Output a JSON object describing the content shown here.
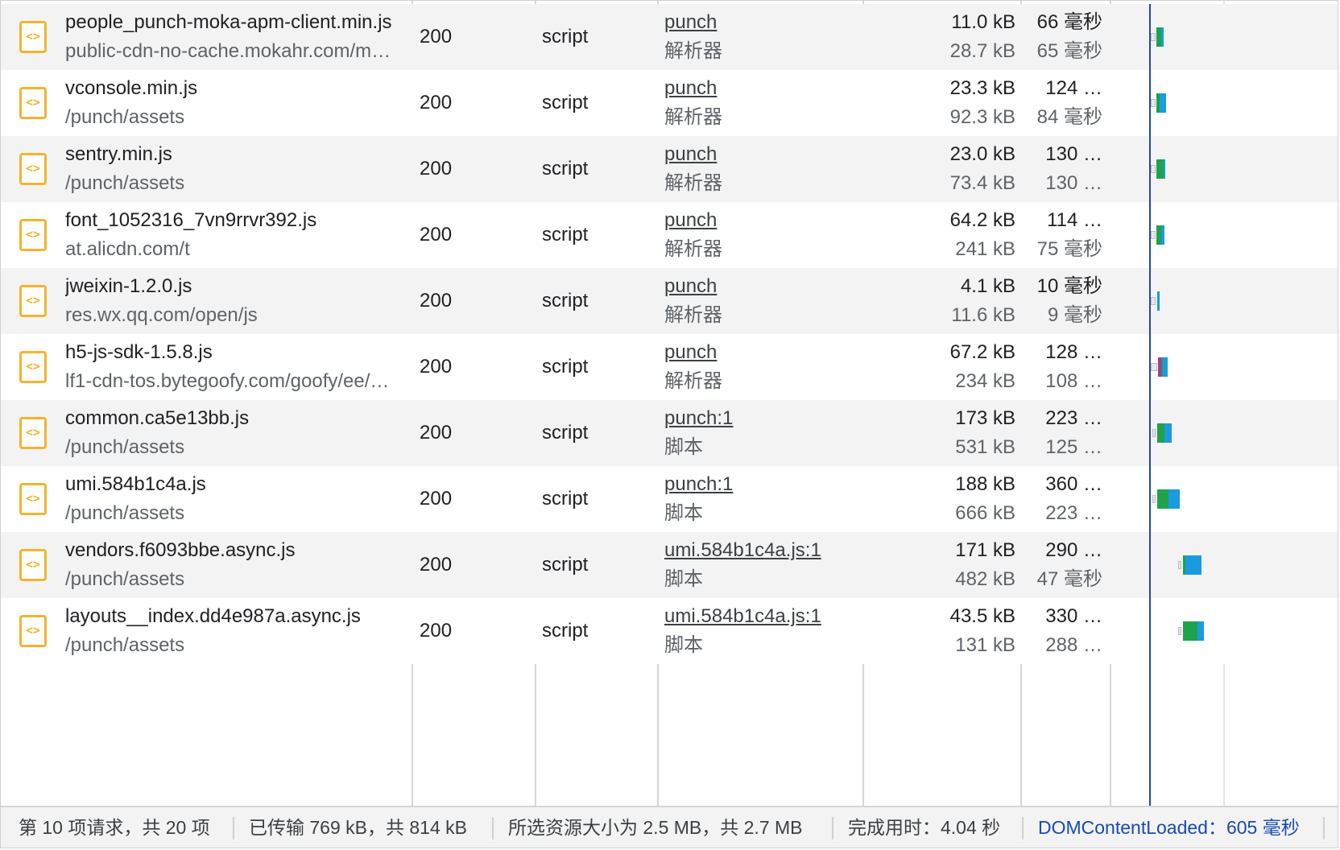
{
  "table": {
    "rows": [
      {
        "name": "people_punch-moka-apm-client.min.js",
        "domain": "public-cdn-no-cache.mokahr.com/m…",
        "status": "200",
        "type": "script",
        "initiator": "punch",
        "initiator_type": "解析器",
        "transferred": "11.0 kB",
        "size": "28.7 kB",
        "time": "66 毫秒",
        "latency": "65 毫秒",
        "icon": "script-file-icon"
      },
      {
        "name": "vconsole.min.js",
        "domain": "/punch/assets",
        "status": "200",
        "type": "script",
        "initiator": "punch",
        "initiator_type": "解析器",
        "transferred": "23.3 kB",
        "size": "92.3 kB",
        "time": "124 …",
        "latency": "84 毫秒",
        "icon": "script-file-icon"
      },
      {
        "name": "sentry.min.js",
        "domain": "/punch/assets",
        "status": "200",
        "type": "script",
        "initiator": "punch",
        "initiator_type": "解析器",
        "transferred": "23.0 kB",
        "size": "73.4 kB",
        "time": "130 …",
        "latency": "130 …",
        "icon": "script-file-icon"
      },
      {
        "name": "font_1052316_7vn9rrvr392.js",
        "domain": "at.alicdn.com/t",
        "status": "200",
        "type": "script",
        "initiator": "punch",
        "initiator_type": "解析器",
        "transferred": "64.2 kB",
        "size": "241 kB",
        "time": "114 …",
        "latency": "75 毫秒",
        "icon": "script-file-icon"
      },
      {
        "name": "jweixin-1.2.0.js",
        "domain": "res.wx.qq.com/open/js",
        "status": "200",
        "type": "script",
        "initiator": "punch",
        "initiator_type": "解析器",
        "transferred": "4.1 kB",
        "size": "11.6 kB",
        "time": "10 毫秒",
        "latency": "9 毫秒",
        "icon": "script-file-icon"
      },
      {
        "name": "h5-js-sdk-1.5.8.js",
        "domain": "lf1-cdn-tos.bytegoofy.com/goofy/ee/…",
        "status": "200",
        "type": "script",
        "initiator": "punch",
        "initiator_type": "解析器",
        "transferred": "67.2 kB",
        "size": "234 kB",
        "time": "128 …",
        "latency": "108 …",
        "icon": "script-file-icon"
      },
      {
        "name": "common.ca5e13bb.js",
        "domain": "/punch/assets",
        "status": "200",
        "type": "script",
        "initiator": "punch:1",
        "initiator_type": "脚本",
        "transferred": "173 kB",
        "size": "531 kB",
        "time": "223 …",
        "latency": "125 …",
        "icon": "script-file-icon"
      },
      {
        "name": "umi.584b1c4a.js",
        "domain": "/punch/assets",
        "status": "200",
        "type": "script",
        "initiator": "punch:1",
        "initiator_type": "脚本",
        "transferred": "188 kB",
        "size": "666 kB",
        "time": "360 …",
        "latency": "223 …",
        "icon": "script-file-icon"
      },
      {
        "name": "vendors.f6093bbe.async.js",
        "domain": "/punch/assets",
        "status": "200",
        "type": "script",
        "initiator": "umi.584b1c4a.js:1",
        "initiator_type": "脚本",
        "transferred": "171 kB",
        "size": "482 kB",
        "time": "290 …",
        "latency": "47 毫秒",
        "icon": "script-file-icon"
      },
      {
        "name": "layouts__index.dd4e987a.async.js",
        "domain": "/punch/assets",
        "status": "200",
        "type": "script",
        "initiator": "umi.584b1c4a.js:1",
        "initiator_type": "脚本",
        "transferred": "43.5 kB",
        "size": "131 kB",
        "time": "330 …",
        "latency": "288 …",
        "icon": "script-file-icon"
      }
    ]
  },
  "colors": {
    "icon": "#f2b431",
    "waiting": "#1fa34a",
    "download": "#1a9be0",
    "ssl": "#b0339c",
    "dcl_line": "#1a4bb0"
  },
  "footer": {
    "requests": "第 10 项请求，共 20 项",
    "transferred": "已传输 769 kB，共 814 kB",
    "resources": "所选资源大小为 2.5 MB，共 2.7 MB",
    "finish": "完成用时：4.04 秒",
    "dcl": "DOMContentLoaded：605 毫秒"
  }
}
